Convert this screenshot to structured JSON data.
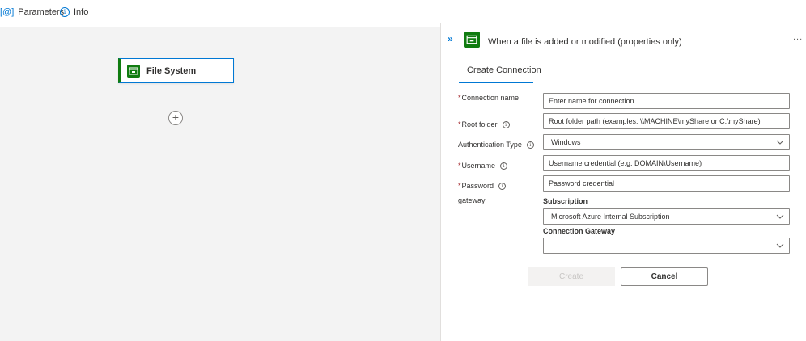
{
  "toolbar": {
    "parameters_label": "Parameters",
    "info_label": "Info"
  },
  "canvas": {
    "node_label": "File System",
    "add_symbol": "+"
  },
  "panel": {
    "title": "When a file is added or modified (properties only)",
    "collapse_symbol": "»",
    "more_symbol": "...",
    "tab_label": "Create Connection",
    "form": {
      "connection_name": {
        "label": "Connection name",
        "required": "*",
        "placeholder": "Enter name for connection"
      },
      "root_folder": {
        "label": "Root folder",
        "required": "*",
        "placeholder": "Root folder path (examples: \\\\MACHINE\\myShare or C:\\myShare)"
      },
      "auth_type": {
        "label": "Authentication Type",
        "value": "Windows"
      },
      "username": {
        "label": "Username",
        "required": "*",
        "placeholder": "Username credential (e.g. DOMAIN\\Username)"
      },
      "password": {
        "label": "Password",
        "required": "*",
        "placeholder": "Password credential"
      },
      "gateway": {
        "label": "gateway",
        "subscription_label": "Subscription",
        "subscription_value": "Microsoft Azure Internal Subscription",
        "connection_gateway_label": "Connection Gateway",
        "connection_gateway_value": ""
      }
    },
    "buttons": {
      "create_label": "Create",
      "cancel_label": "Cancel"
    }
  },
  "colors": {
    "accent": "#0078d4",
    "brand_green": "#107c10",
    "required": "#a4262c"
  }
}
